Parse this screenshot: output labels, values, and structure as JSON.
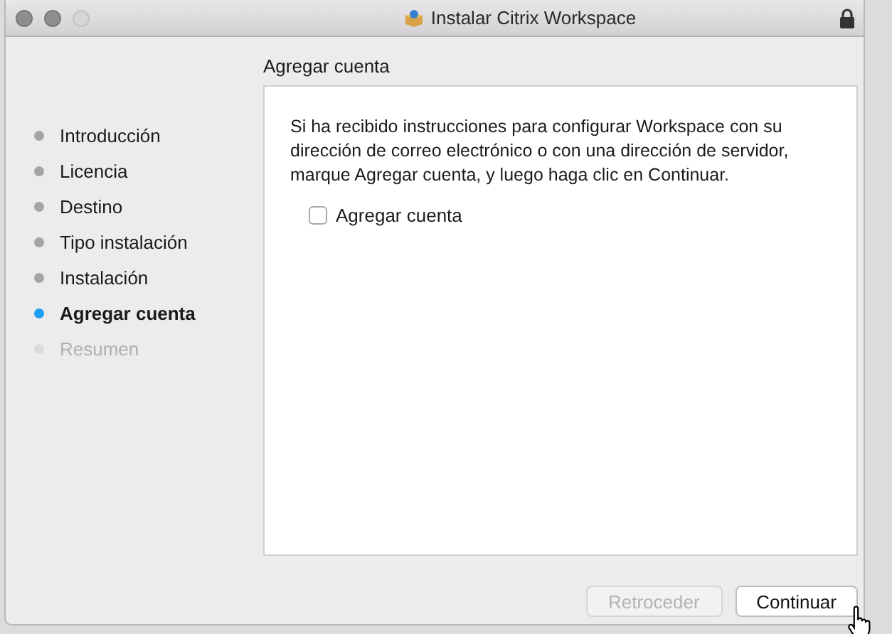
{
  "window": {
    "title": "Instalar Citrix Workspace",
    "locked": true
  },
  "steps": [
    {
      "label": "Introducción",
      "selected": false,
      "disabled": false
    },
    {
      "label": "Licencia",
      "selected": false,
      "disabled": false
    },
    {
      "label": "Destino",
      "selected": false,
      "disabled": false
    },
    {
      "label": "Tipo instalación",
      "selected": false,
      "disabled": false
    },
    {
      "label": "Instalación",
      "selected": false,
      "disabled": false
    },
    {
      "label": "Agregar cuenta",
      "selected": true,
      "disabled": false
    },
    {
      "label": "Resumen",
      "selected": false,
      "disabled": true
    }
  ],
  "page": {
    "heading": "Agregar cuenta",
    "text": "Si ha recibido instrucciones para configurar Workspace con su dirección de correo electrónico o con una dirección de servidor, marque Agregar cuenta, y luego haga clic en Continuar.",
    "checkbox": {
      "label": "Agregar cuenta",
      "checked": false
    }
  },
  "buttons": [
    {
      "label": "Retroceder",
      "disabled": true
    },
    {
      "label": "Continuar",
      "disabled": false
    }
  ]
}
